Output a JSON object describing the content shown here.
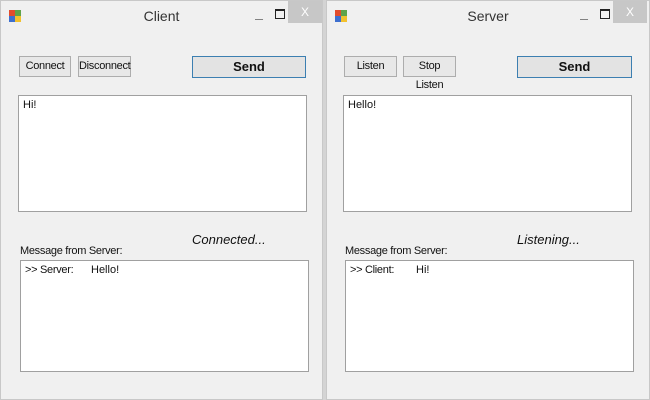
{
  "client": {
    "title": "Client",
    "minimize_label": "_",
    "close_label": "X",
    "connect_label": "Connect",
    "disconnect_label": "Disconnect",
    "send_label": "Send",
    "input_text": "Hi!",
    "status": "Connected...",
    "messages_label": "Message from Server:",
    "messages": [
      {
        "prefix": ">> Server:",
        "text": "Hello!"
      }
    ]
  },
  "server": {
    "title": "Server",
    "minimize_label": "_",
    "close_label": "X",
    "listen_label": "Listen",
    "stop_listen_label": "Stop Listen",
    "send_label": "Send",
    "input_text": "Hello!",
    "status": "Listening...",
    "messages_label": "Message from Server:",
    "messages": [
      {
        "prefix": ">> Client:",
        "text": "Hi!"
      }
    ]
  }
}
